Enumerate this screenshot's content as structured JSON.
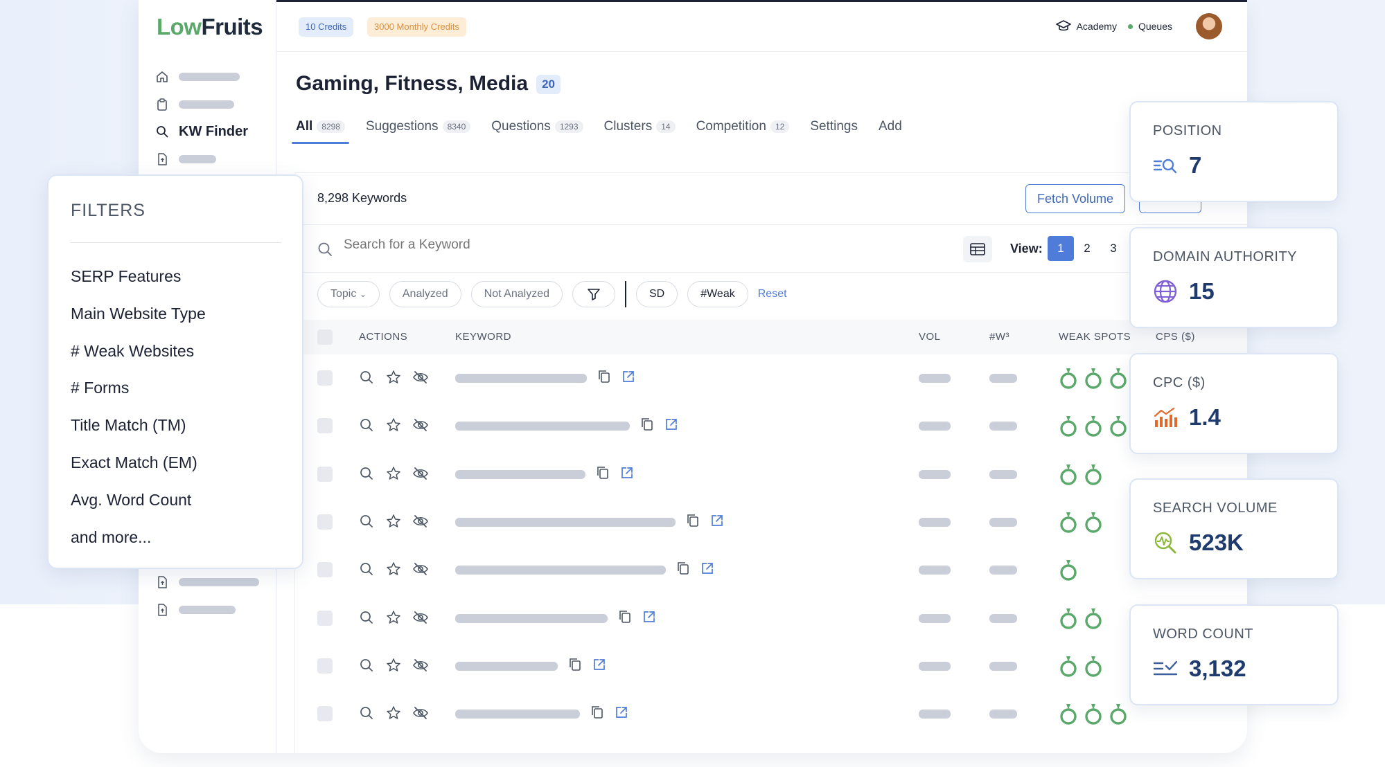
{
  "app": {
    "logo_part1": "Low",
    "logo_part2": "Fruits",
    "credits_badge": "10 Credits",
    "monthly_credits_badge": "3000 Monthly Credits",
    "academy_label": "Academy",
    "queues_label": "Queues"
  },
  "sidebar": {
    "active_item": "KW Finder"
  },
  "project": {
    "title": "Gaming, Fitness, Media",
    "count": "20"
  },
  "tabs": [
    {
      "label": "All",
      "count": "8298"
    },
    {
      "label": "Suggestions",
      "count": "8340"
    },
    {
      "label": "Questions",
      "count": "1293"
    },
    {
      "label": "Clusters",
      "count": "14"
    },
    {
      "label": "Competition",
      "count": "12"
    },
    {
      "label": "Settings",
      "count": ""
    },
    {
      "label": "Add",
      "count": ""
    }
  ],
  "toolbar": {
    "keyword_count": "8,298 Keywords",
    "fetch_volume": "Fetch Volume",
    "search_placeholder": "Search for a Keyword",
    "view_label": "View:",
    "view_pages": [
      "1",
      "2",
      "3"
    ]
  },
  "chips": {
    "topic": "Topic",
    "analyzed": "Analyzed",
    "not_analyzed": "Not Analyzed",
    "sd": "SD",
    "weak": "#Weak",
    "reset": "Reset"
  },
  "table": {
    "headers": {
      "actions": "ACTIONS",
      "keyword": "KEYWORD",
      "vol": "VOL",
      "w": "#W³",
      "weak_spots": "WEAK SPOTS",
      "cps": "CPS ($)"
    },
    "rows": [
      {
        "weak_spots": 3
      },
      {
        "weak_spots": 3
      },
      {
        "weak_spots": 2
      },
      {
        "weak_spots": 2
      },
      {
        "weak_spots": 1
      },
      {
        "weak_spots": 2
      },
      {
        "weak_spots": 2
      },
      {
        "weak_spots": 3
      }
    ]
  },
  "filters": {
    "title": "FILTERS",
    "items": [
      "SERP Features",
      "Main Website Type",
      "# Weak Websites",
      "# Forms",
      "Title Match (TM)",
      "Exact Match (EM)",
      "Avg. Word Count",
      "and more..."
    ]
  },
  "stats": [
    {
      "label": "POSITION",
      "value": "7",
      "icon": "position-search-icon"
    },
    {
      "label": "DOMAIN AUTHORITY",
      "value": "15",
      "icon": "globe-icon"
    },
    {
      "label": "CPC ($)",
      "value": "1.4",
      "icon": "bar-chart-trend-icon"
    },
    {
      "label": "SEARCH VOLUME",
      "value": "523K",
      "icon": "search-pulse-icon"
    },
    {
      "label": "WORD COUNT",
      "value": "3,132",
      "icon": "list-check-icon"
    }
  ],
  "colors": {
    "accent": "#4f7cd9",
    "brand_green": "#5aa86a",
    "weak_spot": "#5aa86a",
    "value_text": "#1f3a6d"
  }
}
